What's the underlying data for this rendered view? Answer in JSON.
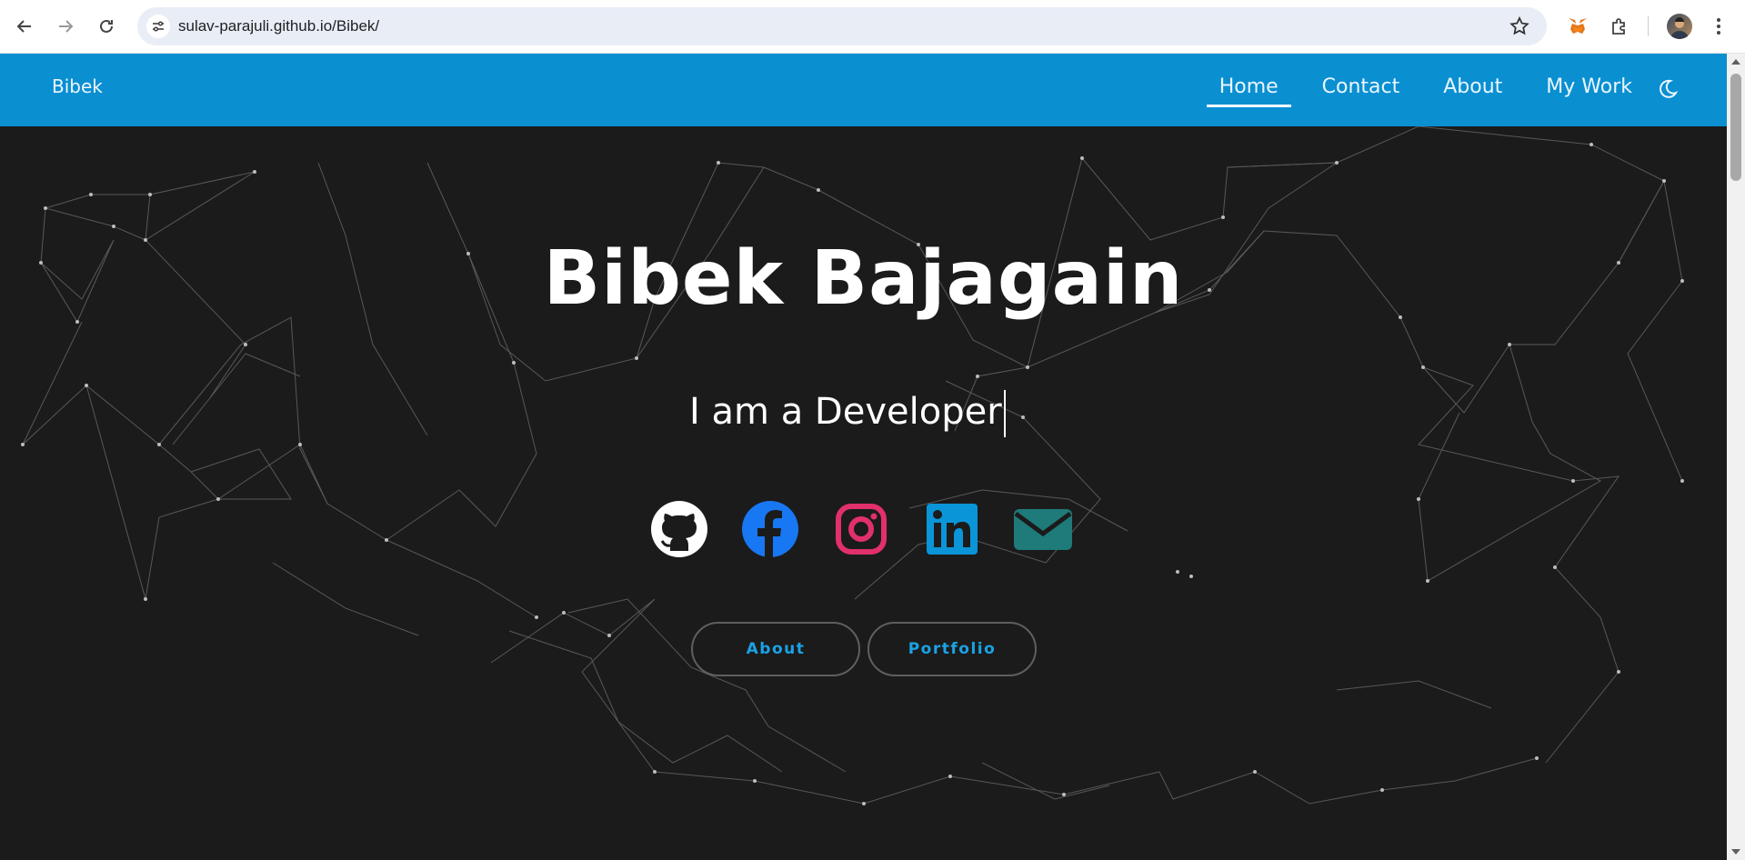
{
  "browser": {
    "url": "sulav-parajuli.github.io/Bibek/",
    "icons": [
      "back-arrow-icon",
      "forward-arrow-icon",
      "reload-icon",
      "site-info-icon",
      "bookmark-star-icon",
      "metamask-fox-icon",
      "extensions-puzzle-icon",
      "profile-avatar",
      "more-menu-icon"
    ]
  },
  "navbar": {
    "brand": "Bibek",
    "items": [
      {
        "label": "Home",
        "active": true
      },
      {
        "label": "Contact",
        "active": false
      },
      {
        "label": "About",
        "active": false
      },
      {
        "label": "My Work",
        "active": false
      }
    ],
    "theme_toggle_icon": "moon-icon",
    "background": "#0a8fd1"
  },
  "hero": {
    "title": "Bibek Bajagain",
    "typed_text": "I am a Developer"
  },
  "socials": [
    {
      "name": "GitHub",
      "icon": "github-icon",
      "color": "#ffffff"
    },
    {
      "name": "Facebook",
      "icon": "facebook-icon",
      "color": "#1877f2"
    },
    {
      "name": "Instagram",
      "icon": "instagram-icon",
      "color": "#e1306c"
    },
    {
      "name": "LinkedIn",
      "icon": "linkedin-icon",
      "color": "#0a95d8"
    },
    {
      "name": "Email",
      "icon": "envelope-icon",
      "color": "#1f7a7a"
    }
  ],
  "buttons": {
    "about": "About",
    "portfolio": "Portfolio"
  },
  "colors": {
    "page_background": "#1b1b1b",
    "accent": "#1aa2e6"
  }
}
